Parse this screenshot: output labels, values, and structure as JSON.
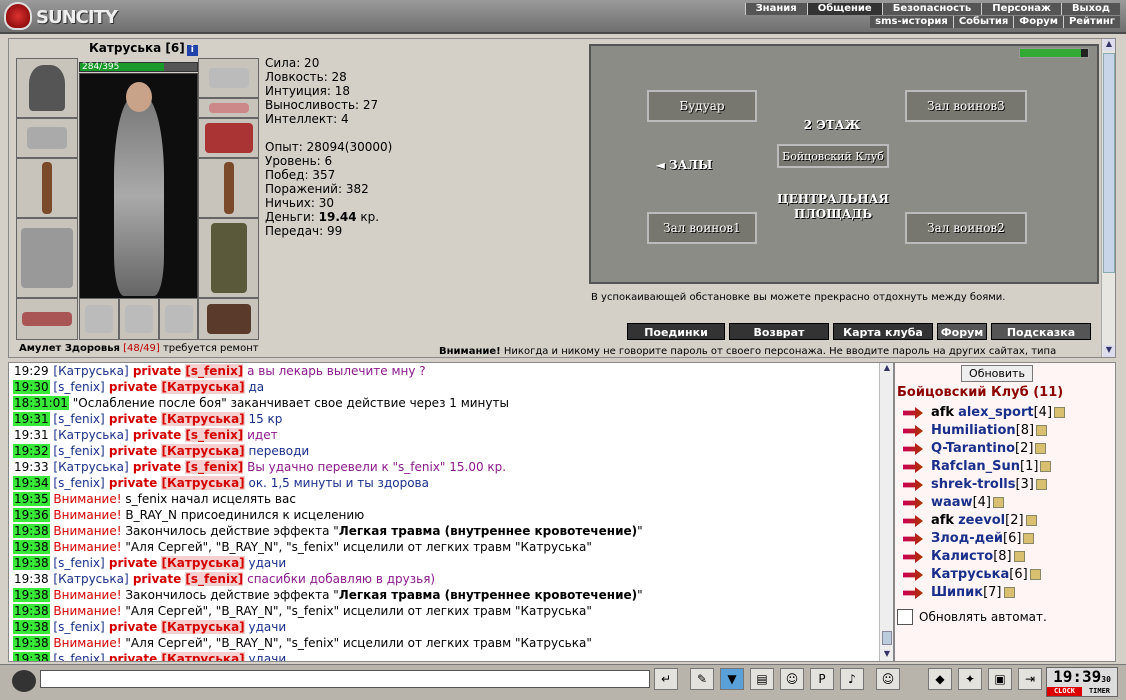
{
  "header": {
    "logo_text": "SUNCITY",
    "menu_top": [
      "Знания",
      "Общение",
      "Безопасность",
      "Персонаж",
      "Выход"
    ],
    "menu_top_active": "Общение",
    "menu_sub": [
      "sms-история",
      "События",
      "Форум",
      "Рейтинг"
    ]
  },
  "character": {
    "name": "Катруська",
    "level": "[6]",
    "hp": "284/395",
    "hp_fraction": 0.72,
    "stats": [
      "Сила: 20",
      "Ловкость: 28",
      "Интуиция: 18",
      "Выносливость: 27",
      "Интеллект: 4"
    ],
    "progress": [
      "Опыт: 28094(30000)",
      "Уровень: 6",
      "Побед: 357",
      "Поражений: 382",
      "Ничьих: 30"
    ],
    "money_label": "Деньги: ",
    "money_value": "19.44",
    "money_unit": " кр.",
    "transfers": "Передач: 99",
    "amulet_name": "Амулет Здоровья",
    "amulet_dur": "[48/49]",
    "amulet_note": " требуется ремонт"
  },
  "map": {
    "rooms": [
      "Будуар",
      "Зал воинов3",
      "Бойцовский Клуб",
      "Зал воинов1",
      "Зал воинов2"
    ],
    "floor": "2 ЭТАЖ",
    "halls": "◄ ЗАЛЫ",
    "square": "ЦЕНТРАЛЬНАЯ ПЛОЩАДЬ",
    "caption": "В успокаивающей обстановке вы можете прекрасно отдохнуть между боями."
  },
  "nav": [
    "Поединки",
    "Возврат",
    "Карта клуба",
    "Форум",
    "Подсказка"
  ],
  "warning": {
    "bold": "Внимание!",
    "text": " Никогда и никому не говорите пароль от своего персонажа. Не вводите пароль на других сайтах, типа"
  },
  "chat": [
    {
      "t": "19:29",
      "hl": false,
      "parts": [
        [
          "nick",
          "[Катруська]"
        ],
        [
          "priv",
          " private "
        ],
        [
          "pnick",
          "[s_fenix]"
        ],
        [
          "mp",
          " а вы лекарь вылечите мну ?"
        ]
      ]
    },
    {
      "t": "19:30",
      "hl": true,
      "parts": [
        [
          "nick",
          "[s_fenix]"
        ],
        [
          "priv",
          " private "
        ],
        [
          "pnick",
          "[Катруська]"
        ],
        [
          "mpo",
          " да"
        ]
      ]
    },
    {
      "t": "18:31:01",
      "hl": true,
      "parts": [
        [
          "plain",
          " \"Ослабление после боя\" заканчивает свое действие через 1 минуты"
        ]
      ]
    },
    {
      "t": "19:31",
      "hl": true,
      "parts": [
        [
          "nick",
          "[s_fenix]"
        ],
        [
          "priv",
          " private "
        ],
        [
          "pnick",
          "[Катруська]"
        ],
        [
          "mpo",
          " 15 кр"
        ]
      ]
    },
    {
      "t": "19:31",
      "hl": false,
      "parts": [
        [
          "nick",
          "[Катруська]"
        ],
        [
          "priv",
          " private "
        ],
        [
          "pnick",
          "[s_fenix]"
        ],
        [
          "mp",
          " идет"
        ]
      ]
    },
    {
      "t": "19:32",
      "hl": true,
      "parts": [
        [
          "nick",
          "[s_fenix]"
        ],
        [
          "priv",
          " private "
        ],
        [
          "pnick",
          "[Катруська]"
        ],
        [
          "mpo",
          " переводи"
        ]
      ]
    },
    {
      "t": "19:33",
      "hl": false,
      "parts": [
        [
          "nick",
          "[Катруська]"
        ],
        [
          "priv",
          " private "
        ],
        [
          "pnick",
          "[s_fenix]"
        ],
        [
          "mp",
          " Вы удачно перевели к \"s_fenix\" 15.00 кр."
        ]
      ]
    },
    {
      "t": "19:34",
      "hl": true,
      "parts": [
        [
          "nick",
          "[s_fenix]"
        ],
        [
          "priv",
          " private "
        ],
        [
          "pnick",
          "[Катруська]"
        ],
        [
          "mpo",
          " ок. 1,5 минуты и ты здорова"
        ]
      ]
    },
    {
      "t": "19:35",
      "hl": true,
      "parts": [
        [
          "warn",
          "Внимание!"
        ],
        [
          "plain",
          " s_fenix начал исцелять вас"
        ]
      ]
    },
    {
      "t": "19:36",
      "hl": true,
      "parts": [
        [
          "warn",
          "Внимание!"
        ],
        [
          "plain",
          " B_RAY_N присоединился к исцелению"
        ]
      ]
    },
    {
      "t": "19:38",
      "hl": true,
      "parts": [
        [
          "warn",
          "Внимание!"
        ],
        [
          "plain",
          " Закончилось действие эффекта \""
        ],
        [
          "bold",
          "Легкая травма (внутреннее кровотечение)"
        ],
        [
          "plain",
          "\""
        ]
      ]
    },
    {
      "t": "19:38",
      "hl": true,
      "parts": [
        [
          "warn",
          "Внимание!"
        ],
        [
          "plain",
          " \"Аля Сергей\", \"B_RAY_N\", \"s_fenix\" исцелили от легких травм \"Катруська\""
        ]
      ]
    },
    {
      "t": "19:38",
      "hl": true,
      "parts": [
        [
          "nick",
          "[s_fenix]"
        ],
        [
          "priv",
          " private "
        ],
        [
          "pnick",
          "[Катруська]"
        ],
        [
          "mpo",
          " удачи"
        ]
      ]
    },
    {
      "t": "19:38",
      "hl": false,
      "parts": [
        [
          "nick",
          "[Катруська]"
        ],
        [
          "priv",
          " private "
        ],
        [
          "pnick",
          "[s_fenix]"
        ],
        [
          "mp",
          " спасибки добавляю в друзья)"
        ]
      ]
    },
    {
      "t": "19:38",
      "hl": true,
      "parts": [
        [
          "warn",
          "Внимание!"
        ],
        [
          "plain",
          " Закончилось действие эффекта \""
        ],
        [
          "bold",
          "Легкая травма (внутреннее кровотечение)"
        ],
        [
          "plain",
          "\""
        ]
      ]
    },
    {
      "t": "19:38",
      "hl": true,
      "parts": [
        [
          "warn",
          "Внимание!"
        ],
        [
          "plain",
          " \"Аля Сергей\", \"B_RAY_N\", \"s_fenix\" исцелили от легких травм \"Катруська\""
        ]
      ]
    },
    {
      "t": "19:38",
      "hl": true,
      "parts": [
        [
          "nick",
          "[s_fenix]"
        ],
        [
          "priv",
          " private "
        ],
        [
          "pnick",
          "[Катруська]"
        ],
        [
          "mpo",
          " удачи"
        ]
      ]
    },
    {
      "t": "19:38",
      "hl": true,
      "parts": [
        [
          "warn",
          "Внимание!"
        ],
        [
          "plain",
          " \"Аля Сергей\", \"B_RAY_N\", \"s_fenix\" исцелили от легких травм \"Катруська\""
        ]
      ]
    },
    {
      "t": "19:38",
      "hl": true,
      "parts": [
        [
          "nick",
          "[s_fenix]"
        ],
        [
          "priv",
          " private "
        ],
        [
          "pnick",
          "[Катруська]"
        ],
        [
          "mpo",
          " удачи"
        ]
      ]
    }
  ],
  "users_panel": {
    "refresh": "Обновить",
    "title": "Бойцовский Клуб (11)",
    "auto": "Обновлять автомат.",
    "users": [
      {
        "afk": "afk",
        "name": "alex_sport",
        "lv": "[4]"
      },
      {
        "afk": "",
        "name": "Humiliation",
        "lv": "[8]"
      },
      {
        "afk": "",
        "name": "Q-Tarantino",
        "lv": "[2]"
      },
      {
        "afk": "",
        "name": "Rafclan_Sun",
        "lv": "[1]"
      },
      {
        "afk": "",
        "name": "shrek-trolls",
        "lv": "[3]"
      },
      {
        "afk": "",
        "name": "waaw",
        "lv": "[4]"
      },
      {
        "afk": "afk",
        "name": "zeevol",
        "lv": "[2]"
      },
      {
        "afk": "",
        "name": "Злод-дей",
        "lv": "[6]"
      },
      {
        "afk": "",
        "name": "Калисто",
        "lv": "[8]"
      },
      {
        "afk": "",
        "name": "Катруська",
        "lv": "[6]"
      },
      {
        "afk": "",
        "name": "Шипик",
        "lv": "[7]"
      }
    ]
  },
  "clock": {
    "time": "19:39",
    "sec": "30",
    "clock_label": "CLOCK",
    "timer_label": "TIMER"
  },
  "colors": {
    "hp": "#1a9a2a",
    "priv": "#d40000",
    "nick": "#1a2f8a",
    "time_hl": "#38e838"
  }
}
